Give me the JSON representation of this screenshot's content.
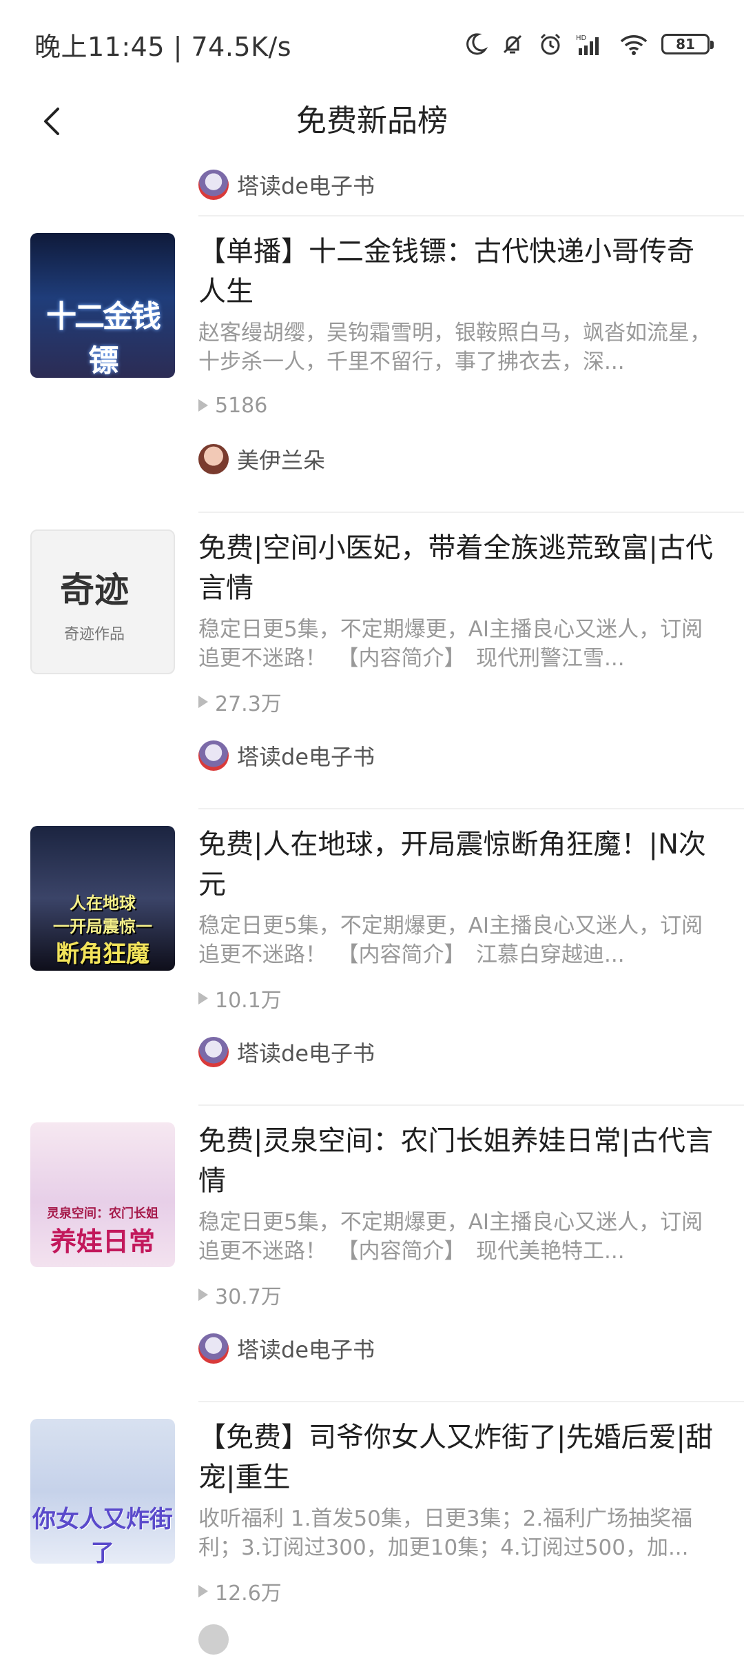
{
  "status_bar": {
    "time": "晚上11:45 | 74.5K/s",
    "battery": "81"
  },
  "header": {
    "title": "免费新品榜"
  },
  "top_author": {
    "name": "塔读de电子书"
  },
  "items": [
    {
      "cover_text": "十二金钱镖",
      "title": "【单播】十二金钱镖：古代快递小哥传奇人生",
      "desc": "赵客缦胡缨，吴钩霜雪明，银鞍照白马，飒沓如流星，十步杀一人，千里不留行，事了拂衣去，深...",
      "plays": "5186",
      "author": "美伊兰朵"
    },
    {
      "cover_text": "奇迹",
      "cover_subtext": "奇迹作品",
      "title": "免费|空间小医妃，带着全族逃荒致富|古代言情",
      "desc": "稳定日更5集，不定期爆更，AI主播良心又迷人，订阅追更不迷路！　【内容简介】　现代刑警江雪...",
      "plays": "27.3万",
      "author": "塔读de电子书"
    },
    {
      "cover_text": "人在地球",
      "cover_text_2": "一开局震惊一",
      "cover_text_3": "断角狂魔",
      "title": "免费|人在地球，开局震惊断角狂魔！|N次元",
      "desc": "稳定日更5集，不定期爆更，AI主播良心又迷人，订阅追更不迷路！　【内容简介】　江慕白穿越迪...",
      "plays": "10.1万",
      "author": "塔读de电子书"
    },
    {
      "cover_text": "灵泉空间：农门长姐",
      "cover_text_2": "养娃日常",
      "title": "免费|灵泉空间：农门长姐养娃日常|古代言情",
      "desc": "稳定日更5集，不定期爆更，AI主播良心又迷人，订阅追更不迷路！　【内容简介】　现代美艳特工...",
      "plays": "30.7万",
      "author": "塔读de电子书"
    },
    {
      "cover_text": "你女人又炸街了",
      "title": "【免费】司爷你女人又炸街了|先婚后爱|甜宠|重生",
      "desc": "收听福利 1.首发50集，日更3集；2.福利广场抽奖福利；3.订阅过300，加更10集；4.订阅过500，加...",
      "plays": "12.6万",
      "author": ""
    }
  ]
}
